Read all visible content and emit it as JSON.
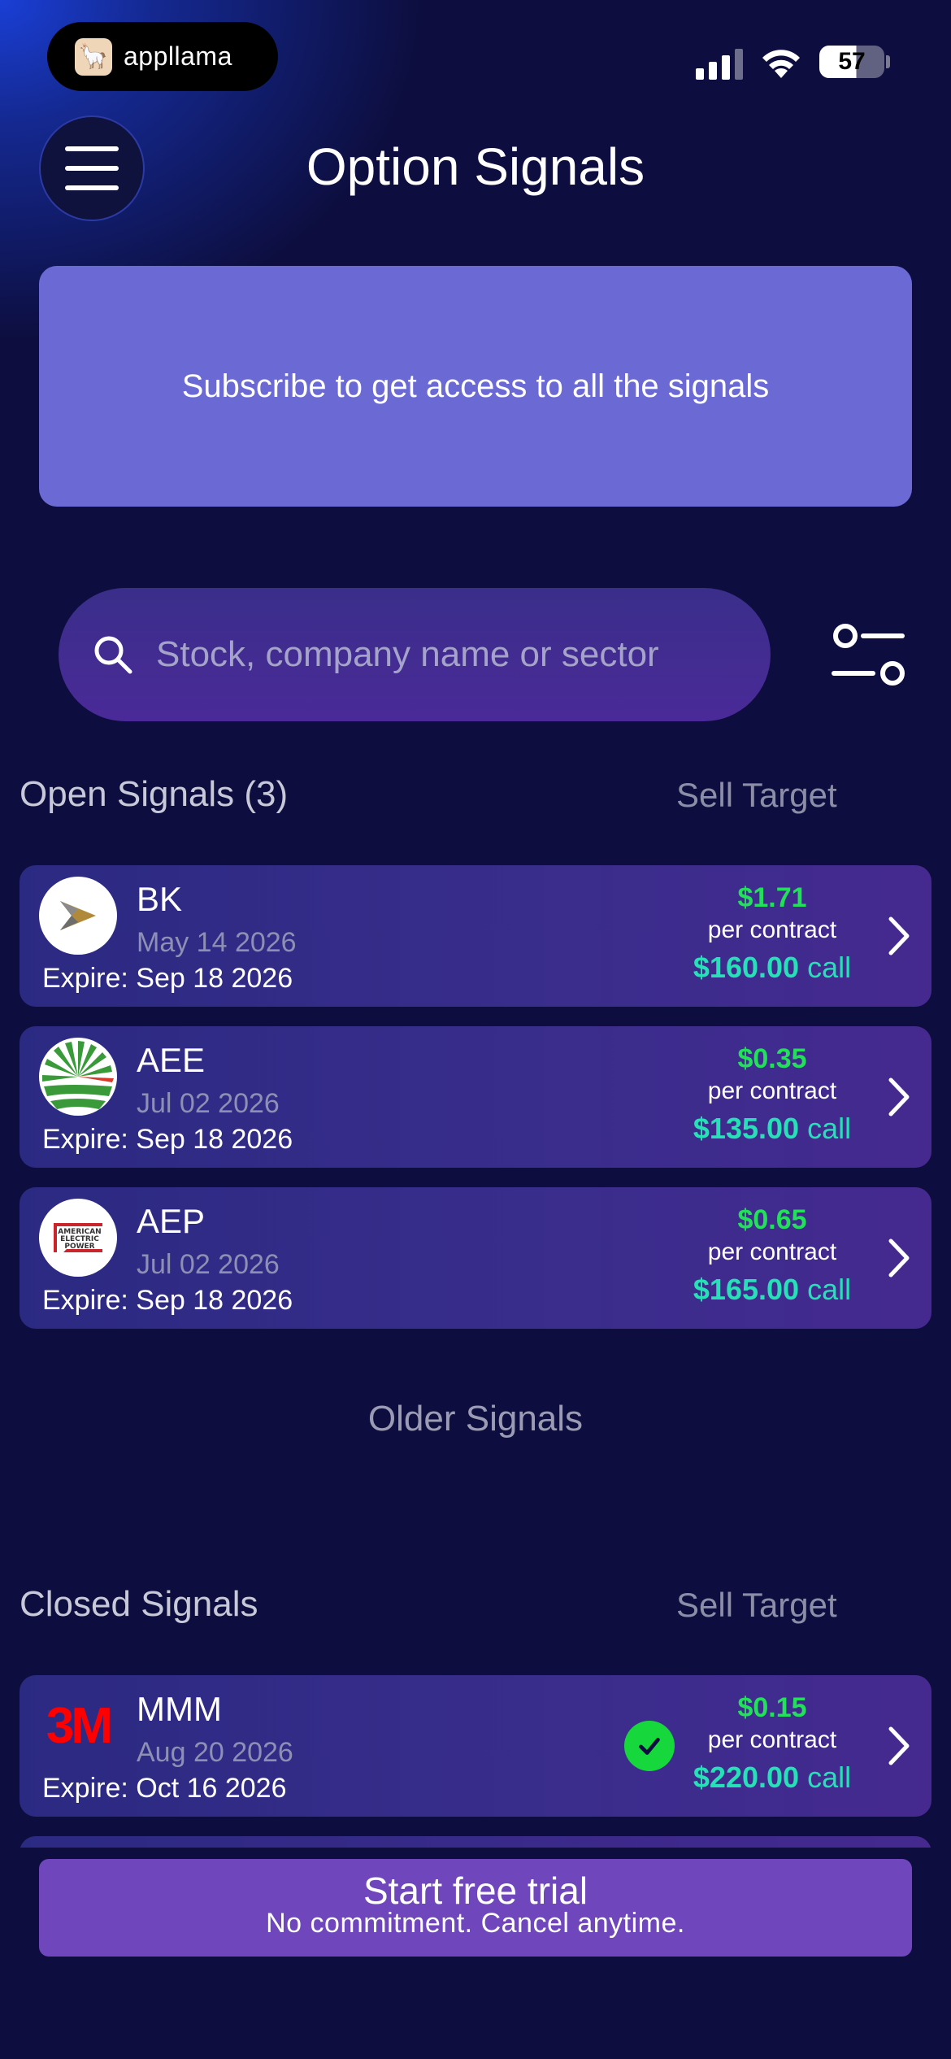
{
  "status_bar": {
    "app_badge": "appllama",
    "battery": "57"
  },
  "header": {
    "title": "Option Signals"
  },
  "banner": {
    "text": "Subscribe to get access to all the signals"
  },
  "search": {
    "placeholder": "Stock, company name or sector"
  },
  "open_signals": {
    "title": "Open Signals (3)",
    "right_label": "Sell Target",
    "items": [
      {
        "ticker": "BK",
        "date": "May 14 2026",
        "expire": "Expire: Sep 18 2026",
        "price": "$1.71",
        "per": "per contract",
        "strike": "$160.00",
        "type": "call",
        "logo": "bk-logo"
      },
      {
        "ticker": "AEE",
        "date": "Jul 02 2026",
        "expire": "Expire: Sep 18 2026",
        "price": "$0.35",
        "per": "per contract",
        "strike": "$135.00",
        "type": "call",
        "logo": "aee-logo"
      },
      {
        "ticker": "AEP",
        "date": "Jul 02 2026",
        "expire": "Expire: Sep 18 2026",
        "price": "$0.65",
        "per": "per contract",
        "strike": "$165.00",
        "type": "call",
        "logo": "aep-logo",
        "logo_text": [
          "AMERICAN",
          "ELECTRIC",
          "POWER"
        ]
      }
    ]
  },
  "older_signals": {
    "label": "Older Signals"
  },
  "closed_signals": {
    "title": "Closed Signals",
    "right_label": "Sell Target",
    "items": [
      {
        "ticker": "MMM",
        "date": "Aug 20 2026",
        "expire": "Expire: Oct 16 2026",
        "price": "$0.15",
        "per": "per contract",
        "strike": "$220.00",
        "type": "call",
        "logo": "3m-logo",
        "logo_text": "3M",
        "status": "check-icon"
      }
    ]
  },
  "cta": {
    "title": "Start free trial",
    "subtitle": "No commitment. Cancel anytime."
  },
  "colors": {
    "background": "#0d0e3f",
    "banner": "#6b6ad5",
    "cta": "#7046bd",
    "price_green": "#22e05a",
    "strike_teal": "#28e0b8"
  }
}
